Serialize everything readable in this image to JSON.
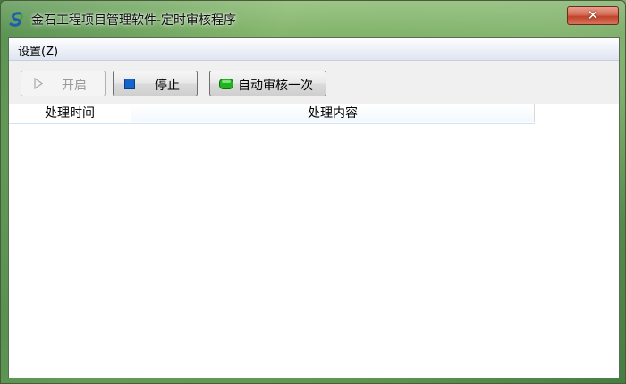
{
  "window": {
    "title": "金石工程项目管理软件-定时审核程序",
    "close_glyph": "✕"
  },
  "menu": {
    "items": [
      {
        "label": "设置(Z)"
      }
    ]
  },
  "toolbar": {
    "start": {
      "label": "开启",
      "enabled": false,
      "icon": "play-triangle-icon"
    },
    "stop": {
      "label": "停止",
      "enabled": true,
      "icon": "stop-square-icon",
      "icon_color": "#1565c9"
    },
    "audit_once": {
      "label": "自动审核一次",
      "enabled": true,
      "icon": "green-pill-icon",
      "icon_color": "#1fb31f"
    }
  },
  "log_table": {
    "columns": [
      "处理时间",
      "处理内容"
    ],
    "rows": []
  }
}
